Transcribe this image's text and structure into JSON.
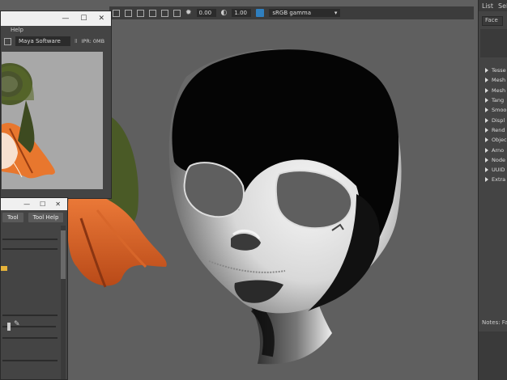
{
  "topbar": {
    "exposure": "0.00",
    "gamma": "1.00",
    "color_space": "sRGB gamma"
  },
  "right_panel": {
    "menu": [
      "List",
      "Selec"
    ],
    "tab": "Face",
    "sections": [
      "Tesse",
      "Mesh",
      "Mesh",
      "Tang",
      "Smoo",
      "Displ",
      "Rend",
      "Objec",
      "Arno",
      "Node",
      "UUID",
      "Extra"
    ],
    "notes_label": "Notes: Fa"
  },
  "render_window": {
    "menu_help": "Help",
    "renderer": "Maya Software",
    "ipr_label": "IPR: 0MB",
    "titlebar_glyphs": [
      "—",
      "☐",
      "✕"
    ]
  },
  "tool_window": {
    "buttons": [
      "Tool",
      "Tool Help"
    ],
    "titlebar_glyphs": [
      "—",
      "☐",
      "✕"
    ]
  }
}
